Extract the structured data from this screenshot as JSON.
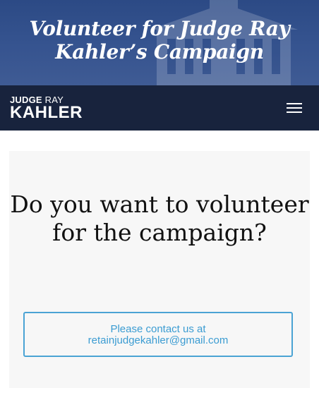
{
  "hero": {
    "title": "Volunteer for Judge Ray Kahler’s Campaign"
  },
  "navbar": {
    "logo_line1_bold": "JUDGE",
    "logo_line1_light": "RAY",
    "logo_line2": "KAHLER",
    "menu_icon": "hamburger-menu-icon"
  },
  "main": {
    "heading": "Do you want to volunteer for the campaign?",
    "contact_line1": "Please contact us at",
    "contact_email": "retainjudgekahler@gmail.com"
  },
  "colors": {
    "hero_bg": "#35538f",
    "navbar_bg": "#18233d",
    "card_bg": "#f7f7f7",
    "accent": "#4aa3d4"
  }
}
